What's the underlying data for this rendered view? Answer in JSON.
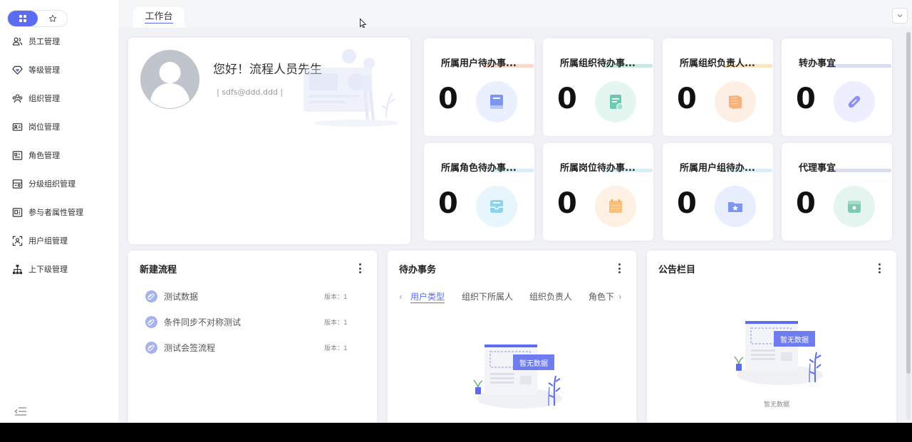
{
  "sidebar": {
    "items": [
      {
        "label": "员工管理"
      },
      {
        "label": "等级管理"
      },
      {
        "label": "组织管理"
      },
      {
        "label": "岗位管理"
      },
      {
        "label": "角色管理"
      },
      {
        "label": "分级组织管理"
      },
      {
        "label": "参与者属性管理"
      },
      {
        "label": "用户组管理"
      },
      {
        "label": "上下级管理"
      }
    ]
  },
  "tabs": [
    {
      "label": "工作台"
    }
  ],
  "profile": {
    "greeting": "您好！流程人员先生",
    "email": "|  sdfs@ddd.ddd   |"
  },
  "stats": [
    {
      "title": "所属用户待办事...",
      "value": "0",
      "color": "#6f8af0"
    },
    {
      "title": "所属组织待办事...",
      "value": "0",
      "color": "#5bbfa6"
    },
    {
      "title": "所属组织负责人...",
      "value": "0",
      "color": "#f3a86a"
    },
    {
      "title": "转办事宜",
      "value": "0",
      "color": "#8c8ff0"
    },
    {
      "title": "所属角色待办事...",
      "value": "0",
      "color": "#6cc6e6"
    },
    {
      "title": "所属岗位待办事...",
      "value": "0",
      "color": "#f6b66d"
    },
    {
      "title": "所属用户组待办...",
      "value": "0",
      "color": "#6f8af0"
    },
    {
      "title": "代理事宜",
      "value": "0",
      "color": "#7fc2a8"
    }
  ],
  "new_flow": {
    "title": "新建流程",
    "items": [
      {
        "name": "测试数据",
        "version": "版本：1"
      },
      {
        "name": "条件同步不对称测试",
        "version": "版本：1"
      },
      {
        "name": "测试会签流程",
        "version": "版本：1"
      }
    ]
  },
  "todo": {
    "title": "待办事务",
    "tabs": [
      "用户类型",
      "组织下所属人",
      "组织负责人",
      "角色下"
    ],
    "empty_badge": "暂无数据"
  },
  "notice": {
    "title": "公告栏目",
    "empty_badge": "暂无数据",
    "empty_text": "暂无数据"
  }
}
